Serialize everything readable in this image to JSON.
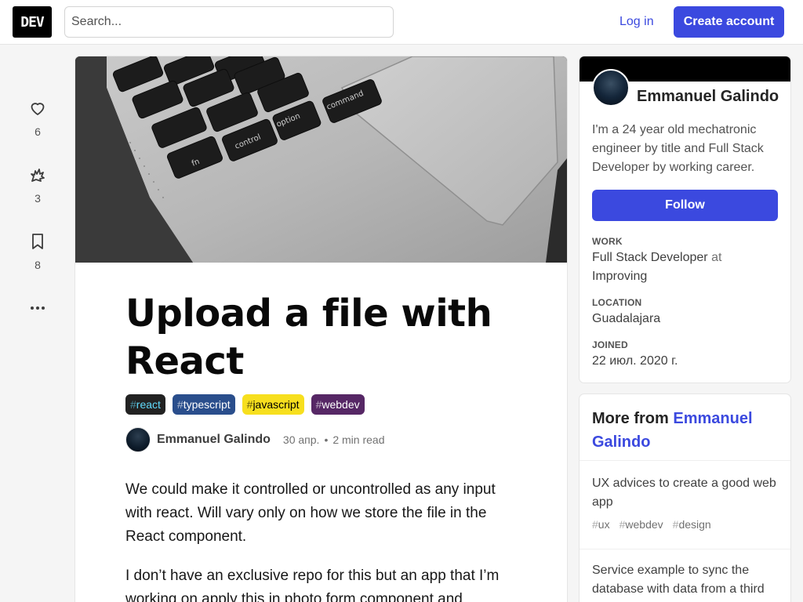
{
  "header": {
    "logo": "DEV",
    "search_placeholder": "Search...",
    "login_label": "Log in",
    "create_account_label": "Create account",
    "accent": "#3b49df"
  },
  "reactions": [
    {
      "icon": "heart-icon",
      "count": "6"
    },
    {
      "icon": "unicorn-icon",
      "count": "3"
    },
    {
      "icon": "bookmark-icon",
      "count": "8"
    },
    {
      "icon": "more-options-icon",
      "count": ""
    }
  ],
  "article": {
    "cover_alt": "laptop keyboard and trackpad photo",
    "title": "Upload a file with React",
    "tags": [
      {
        "hash": "#",
        "name": "react",
        "bg": "#222222",
        "fg": "#61dafb"
      },
      {
        "hash": "#",
        "name": "typescript",
        "bg": "#2a4e8c",
        "fg": "#ffffff"
      },
      {
        "hash": "#",
        "name": "javascript",
        "bg": "#f7df1e",
        "fg": "#000000"
      },
      {
        "hash": "#",
        "name": "webdev",
        "bg": "#562765",
        "fg": "#ffffff"
      }
    ],
    "author": "Emmanuel Galindo",
    "date": "30 апр.",
    "separator": "•",
    "read_time": "2 min read",
    "paragraphs": [
      "We could make it controlled or uncontrolled as any input with react. Will vary only on how we store the file in the React component.",
      "I don’t have an exclusive repo for this but an app that I’m working on apply this in photo form component and"
    ]
  },
  "profile": {
    "name": "Emmanuel Galindo",
    "bio": "I'm a 24 year old mechatronic engineer by title and Full Stack Developer by working career.",
    "follow_label": "Follow",
    "work_label": "Work",
    "work_role": "Full Stack Developer",
    "work_at": "at",
    "work_company": "Improving",
    "location_label": "Location",
    "location": "Guadalajara",
    "joined_label": "Joined",
    "joined": "22 июл. 2020 г."
  },
  "more_from": {
    "prefix": "More from",
    "author": "Emmanuel Galindo",
    "items": [
      {
        "title": "UX advices to create a good web app",
        "tags": [
          "ux",
          "webdev",
          "design"
        ]
      },
      {
        "title": "Service example to sync the database with data from a third",
        "tags": []
      }
    ]
  }
}
